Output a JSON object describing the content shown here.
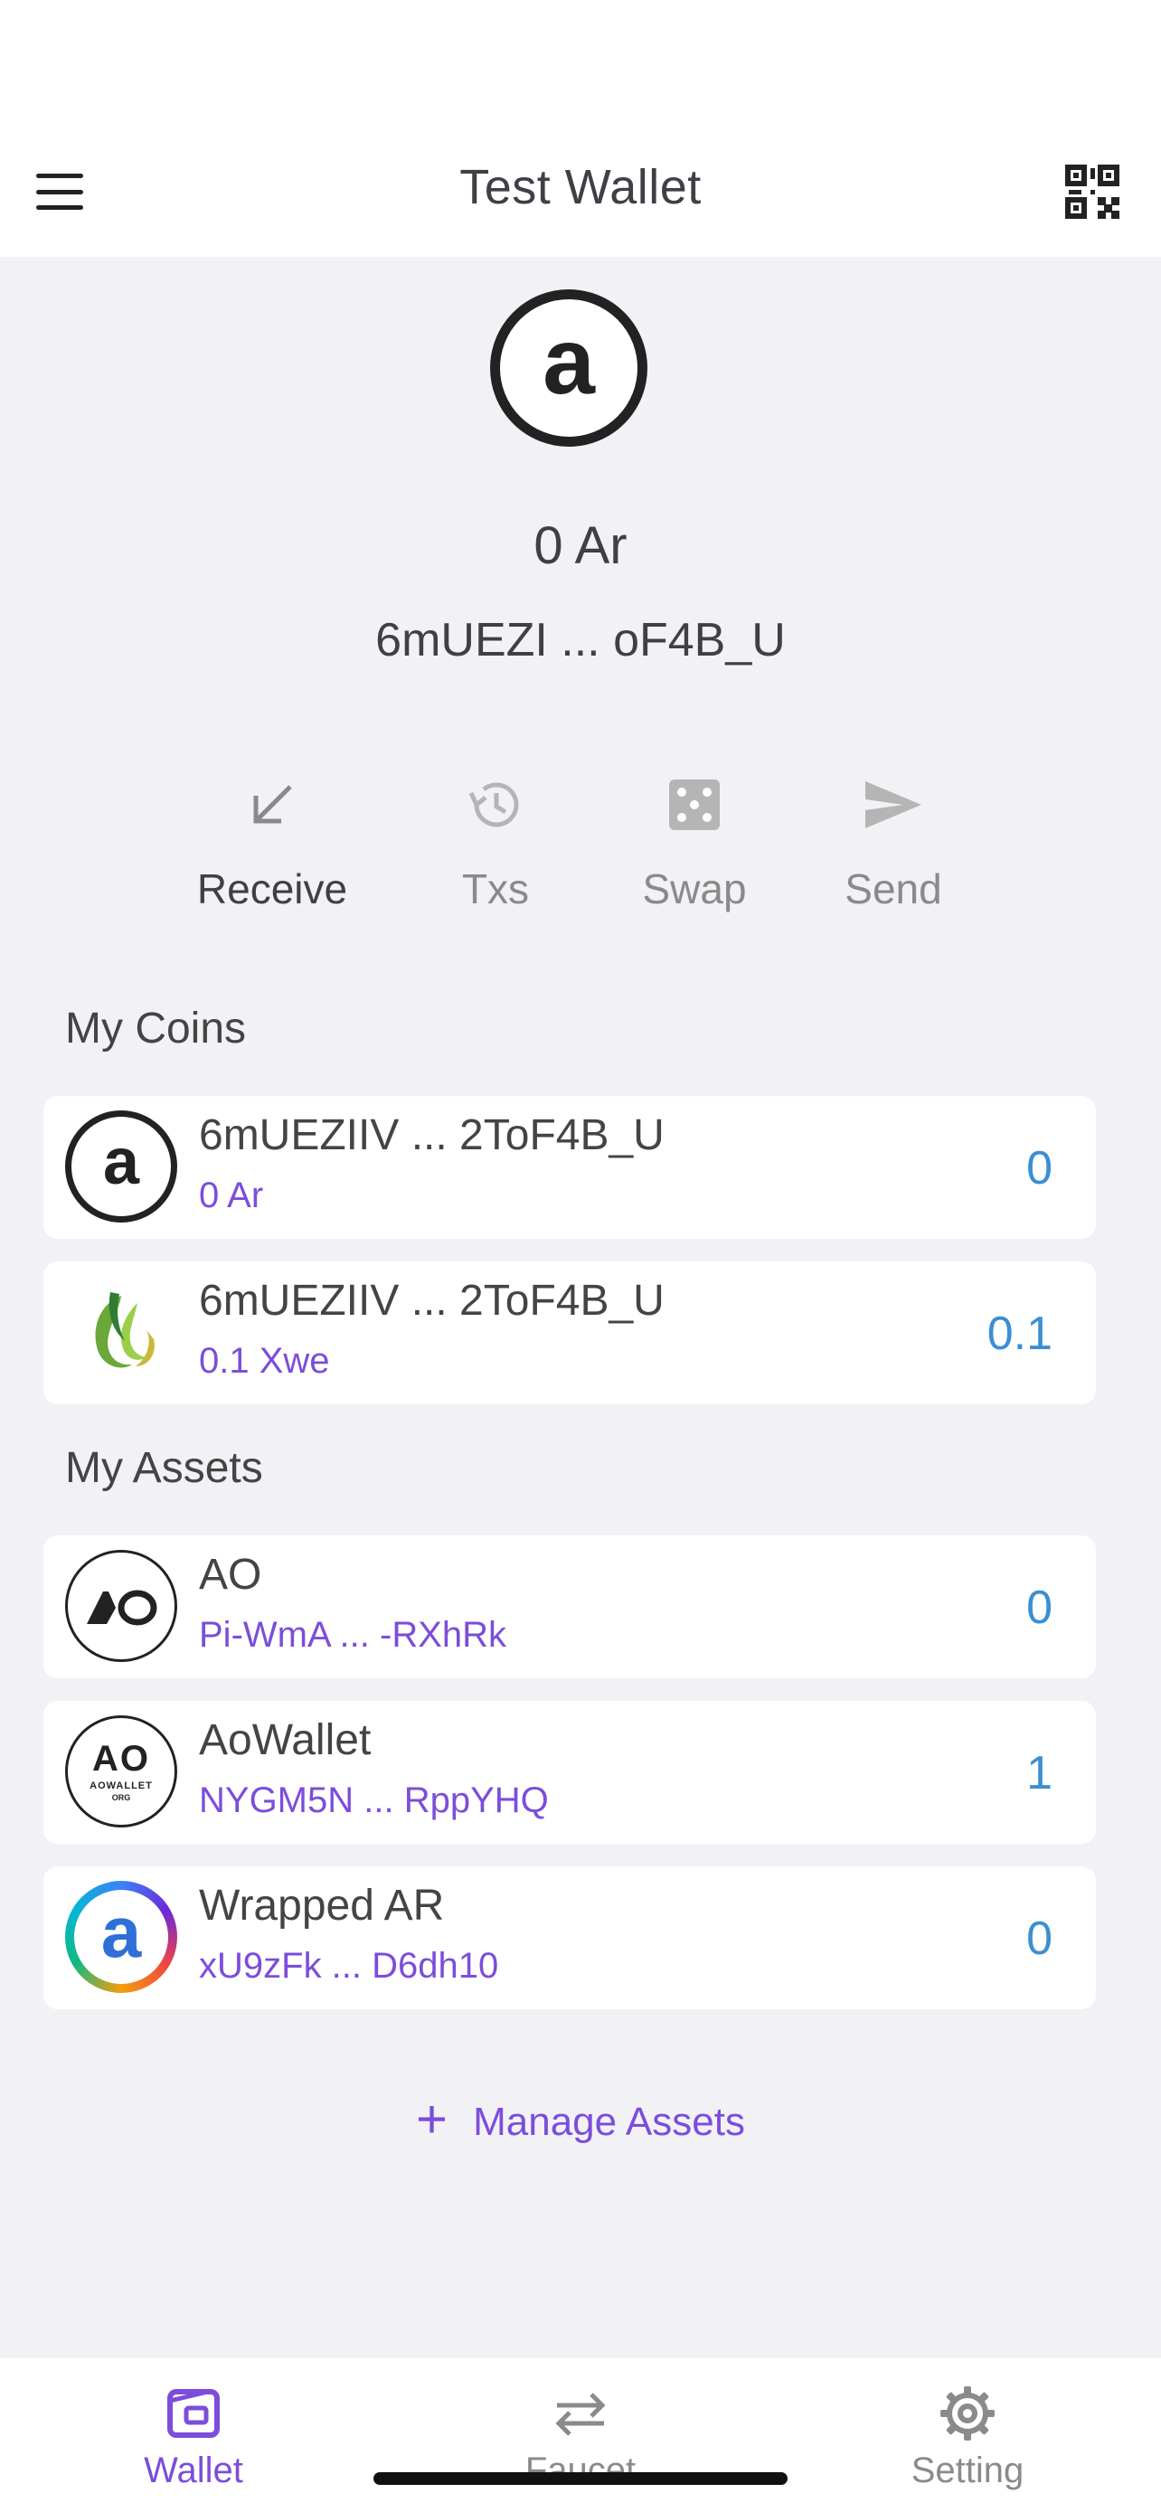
{
  "header": {
    "title": "Test Wallet"
  },
  "hero": {
    "logo_letter": "a",
    "balance": "0 Ar",
    "address": "6mUEZI ... oF4B_U"
  },
  "actions": [
    {
      "label": "Receive",
      "icon": "arrow-down-left-icon"
    },
    {
      "label": "Txs",
      "icon": "history-icon"
    },
    {
      "label": "Swap",
      "icon": "dice-icon"
    },
    {
      "label": "Send",
      "icon": "send-icon"
    }
  ],
  "coins": {
    "title": "My Coins",
    "items": [
      {
        "name": "6mUEZIIV ... 2ToF4B_U",
        "sub": "0 Ar",
        "amount": "0",
        "icon_letter": "a"
      },
      {
        "name": "6mUEZIIV ... 2ToF4B_U",
        "sub": "0.1 Xwe",
        "amount": "0.1"
      }
    ]
  },
  "assets": {
    "title": "My Assets",
    "items": [
      {
        "name": "AO",
        "sub": "Pi-WmA ... -RXhRk",
        "amount": "0"
      },
      {
        "name": "AoWallet",
        "sub": "NYGM5N ... RppYHQ",
        "amount": "1",
        "logo_big": "AO",
        "logo_line1": "AOWALLET",
        "logo_line2": "ORG"
      },
      {
        "name": "Wrapped AR",
        "sub": "xU9zFk ... D6dh10",
        "amount": "0",
        "icon_letter": "a"
      }
    ]
  },
  "manage": {
    "plus": "+",
    "label": "Manage Assets"
  },
  "nav": [
    {
      "label": "Wallet",
      "active": true
    },
    {
      "label": "Faucet"
    },
    {
      "label": "Setting"
    }
  ],
  "colors": {
    "accent": "#7c4ddb",
    "amount": "#3b8ed4",
    "background": "#f2f2f6"
  }
}
